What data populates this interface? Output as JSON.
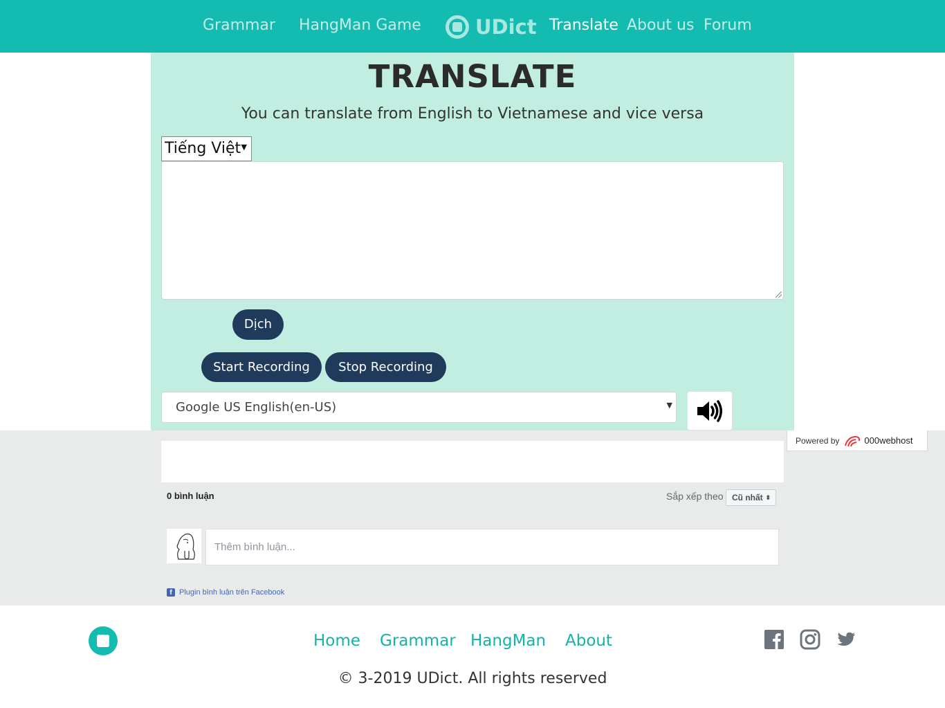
{
  "nav": {
    "grammar": "Grammar",
    "hangman": "HangMan Game",
    "brand": "UDict",
    "translate": "Translate",
    "about": "About us",
    "forum": "Forum"
  },
  "main": {
    "title": "TRANSLATE",
    "subtitle": "You can translate from English to Vietnamese and vice versa",
    "language_selected": "Tiếng Việt",
    "text_value": "",
    "translate_button": "Dịch",
    "start_recording": "Start Recording",
    "stop_recording": "Stop Recording",
    "voice_selected": "Google US English(en-US)"
  },
  "comments": {
    "count_label": "0 bình luận",
    "sort_label": "Sắp xếp theo",
    "sort_selected": "Cũ nhất",
    "input_placeholder": "Thêm bình luận...",
    "plugin_label": "Plugin bình luận trên Facebook"
  },
  "powered": {
    "label": "Powered by",
    "brand": "000webhost"
  },
  "footer": {
    "links": [
      "Home",
      "Grammar",
      "HangMan",
      "About"
    ],
    "copyright": "© 3-2019 UDict. All rights reserved"
  },
  "colors": {
    "nav_bg": "#14bbb0",
    "panel_bg": "#c1eee1",
    "button_bg": "#1f3a5a",
    "footer_link": "#14b3a8"
  }
}
